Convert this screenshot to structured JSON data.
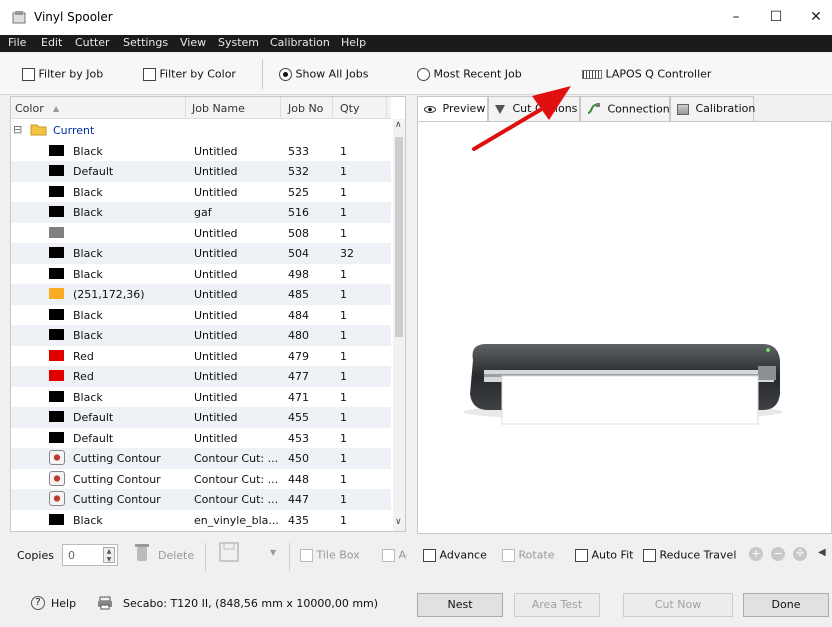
{
  "window": {
    "title": "Vinyl Spooler",
    "minimize": "–",
    "maximize": "☐",
    "close": "✕"
  },
  "menu": [
    "File",
    "Edit",
    "Cutter",
    "Settings",
    "View",
    "System",
    "Calibration",
    "Help"
  ],
  "toolbar": {
    "filter_by_job": "Filter by Job",
    "filter_by_color": "Filter by Color",
    "show_all_jobs": "Show All Jobs",
    "most_recent_job": "Most Recent Job",
    "controller": "LAPOS Q Controller"
  },
  "list": {
    "headers": {
      "color": "Color",
      "job_name": "Job Name",
      "job_no": "Job No",
      "qty": "Qty",
      "sort_indicator": "▲"
    },
    "group": {
      "expander": "⊟",
      "label": "Current"
    },
    "scroll_up": "∧",
    "scroll_down": "∨",
    "rows": [
      {
        "color": "Black",
        "swatch": "#000000",
        "job": "Untitled",
        "no": "533",
        "qty": "1"
      },
      {
        "color": "Default",
        "swatch": "#000000",
        "job": "Untitled",
        "no": "532",
        "qty": "1"
      },
      {
        "color": "Black",
        "swatch": "#000000",
        "job": "Untitled",
        "no": "525",
        "qty": "1"
      },
      {
        "color": "Black",
        "swatch": "#000000",
        "job": "gaf",
        "no": "516",
        "qty": "1"
      },
      {
        "color": "",
        "swatch": "#808080",
        "job": "Untitled",
        "no": "508",
        "qty": "1"
      },
      {
        "color": "Black",
        "swatch": "#000000",
        "job": "Untitled",
        "no": "504",
        "qty": "32"
      },
      {
        "color": "Black",
        "swatch": "#000000",
        "job": "Untitled",
        "no": "498",
        "qty": "1"
      },
      {
        "color": "(251,172,36)",
        "swatch": "#fbac24",
        "job": "Untitled",
        "no": "485",
        "qty": "1"
      },
      {
        "color": "Black",
        "swatch": "#000000",
        "job": "Untitled",
        "no": "484",
        "qty": "1"
      },
      {
        "color": "Black",
        "swatch": "#000000",
        "job": "Untitled",
        "no": "480",
        "qty": "1"
      },
      {
        "color": "Red",
        "swatch": "#e00000",
        "job": "Untitled",
        "no": "479",
        "qty": "1"
      },
      {
        "color": "Red",
        "swatch": "#e00000",
        "job": "Untitled",
        "no": "477",
        "qty": "1"
      },
      {
        "color": "Black",
        "swatch": "#000000",
        "job": "Untitled",
        "no": "471",
        "qty": "1"
      },
      {
        "color": "Default",
        "swatch": "#000000",
        "job": "Untitled",
        "no": "455",
        "qty": "1"
      },
      {
        "color": "Default",
        "swatch": "#000000",
        "job": "Untitled",
        "no": "453",
        "qty": "1"
      },
      {
        "color": "Cutting Contour",
        "swatch": "contour",
        "job": "Contour Cut: ...",
        "no": "450",
        "qty": "1"
      },
      {
        "color": "Cutting Contour",
        "swatch": "contour",
        "job": "Contour Cut: ...",
        "no": "448",
        "qty": "1"
      },
      {
        "color": "Cutting Contour",
        "swatch": "contour",
        "job": "Contour Cut: ...",
        "no": "447",
        "qty": "1"
      },
      {
        "color": "Black",
        "swatch": "#000000",
        "job": "en_vinyle_bla...",
        "no": "435",
        "qty": "1"
      }
    ]
  },
  "tabs": [
    {
      "label": "Preview",
      "icon": "eye-icon",
      "active": true
    },
    {
      "label": "Cut Options",
      "icon": "funnel-icon",
      "active": false
    },
    {
      "label": "Connection",
      "icon": "cable-icon",
      "active": false
    },
    {
      "label": "Calibration",
      "icon": "calibration-icon",
      "active": false
    }
  ],
  "bottom": {
    "copies_label": "Copies",
    "copies_value": "0",
    "delete": "Delete",
    "tile_box": "Tile Box",
    "ad": "Ad",
    "advance": "Advance",
    "rotate": "Rotate",
    "auto_fit": "Auto Fit",
    "reduce_travel": "Reduce Travel"
  },
  "status": {
    "help": "Help",
    "cutter": "Secabo: T120 II,  (848,56 mm x 10000,00 mm)",
    "nest": "Nest",
    "area_test": "Area Test",
    "cut_now": "Cut Now",
    "done": "Done"
  },
  "colors": {
    "group_label": "#0030a0",
    "arrow": "#e01010",
    "menubar": "#1b1b1b"
  }
}
